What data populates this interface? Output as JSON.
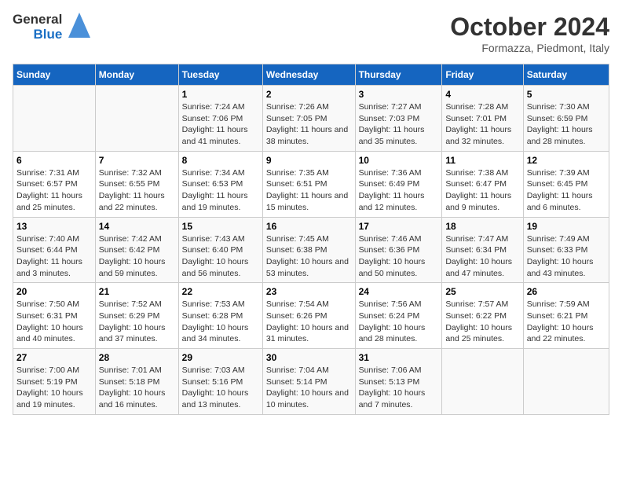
{
  "logo": {
    "general": "General",
    "blue": "Blue"
  },
  "title": "October 2024",
  "subtitle": "Formazza, Piedmont, Italy",
  "days_header": [
    "Sunday",
    "Monday",
    "Tuesday",
    "Wednesday",
    "Thursday",
    "Friday",
    "Saturday"
  ],
  "weeks": [
    [
      {
        "day": "",
        "info": ""
      },
      {
        "day": "",
        "info": ""
      },
      {
        "day": "1",
        "info": "Sunrise: 7:24 AM\nSunset: 7:06 PM\nDaylight: 11 hours and 41 minutes."
      },
      {
        "day": "2",
        "info": "Sunrise: 7:26 AM\nSunset: 7:05 PM\nDaylight: 11 hours and 38 minutes."
      },
      {
        "day": "3",
        "info": "Sunrise: 7:27 AM\nSunset: 7:03 PM\nDaylight: 11 hours and 35 minutes."
      },
      {
        "day": "4",
        "info": "Sunrise: 7:28 AM\nSunset: 7:01 PM\nDaylight: 11 hours and 32 minutes."
      },
      {
        "day": "5",
        "info": "Sunrise: 7:30 AM\nSunset: 6:59 PM\nDaylight: 11 hours and 28 minutes."
      }
    ],
    [
      {
        "day": "6",
        "info": "Sunrise: 7:31 AM\nSunset: 6:57 PM\nDaylight: 11 hours and 25 minutes."
      },
      {
        "day": "7",
        "info": "Sunrise: 7:32 AM\nSunset: 6:55 PM\nDaylight: 11 hours and 22 minutes."
      },
      {
        "day": "8",
        "info": "Sunrise: 7:34 AM\nSunset: 6:53 PM\nDaylight: 11 hours and 19 minutes."
      },
      {
        "day": "9",
        "info": "Sunrise: 7:35 AM\nSunset: 6:51 PM\nDaylight: 11 hours and 15 minutes."
      },
      {
        "day": "10",
        "info": "Sunrise: 7:36 AM\nSunset: 6:49 PM\nDaylight: 11 hours and 12 minutes."
      },
      {
        "day": "11",
        "info": "Sunrise: 7:38 AM\nSunset: 6:47 PM\nDaylight: 11 hours and 9 minutes."
      },
      {
        "day": "12",
        "info": "Sunrise: 7:39 AM\nSunset: 6:45 PM\nDaylight: 11 hours and 6 minutes."
      }
    ],
    [
      {
        "day": "13",
        "info": "Sunrise: 7:40 AM\nSunset: 6:44 PM\nDaylight: 11 hours and 3 minutes."
      },
      {
        "day": "14",
        "info": "Sunrise: 7:42 AM\nSunset: 6:42 PM\nDaylight: 10 hours and 59 minutes."
      },
      {
        "day": "15",
        "info": "Sunrise: 7:43 AM\nSunset: 6:40 PM\nDaylight: 10 hours and 56 minutes."
      },
      {
        "day": "16",
        "info": "Sunrise: 7:45 AM\nSunset: 6:38 PM\nDaylight: 10 hours and 53 minutes."
      },
      {
        "day": "17",
        "info": "Sunrise: 7:46 AM\nSunset: 6:36 PM\nDaylight: 10 hours and 50 minutes."
      },
      {
        "day": "18",
        "info": "Sunrise: 7:47 AM\nSunset: 6:34 PM\nDaylight: 10 hours and 47 minutes."
      },
      {
        "day": "19",
        "info": "Sunrise: 7:49 AM\nSunset: 6:33 PM\nDaylight: 10 hours and 43 minutes."
      }
    ],
    [
      {
        "day": "20",
        "info": "Sunrise: 7:50 AM\nSunset: 6:31 PM\nDaylight: 10 hours and 40 minutes."
      },
      {
        "day": "21",
        "info": "Sunrise: 7:52 AM\nSunset: 6:29 PM\nDaylight: 10 hours and 37 minutes."
      },
      {
        "day": "22",
        "info": "Sunrise: 7:53 AM\nSunset: 6:28 PM\nDaylight: 10 hours and 34 minutes."
      },
      {
        "day": "23",
        "info": "Sunrise: 7:54 AM\nSunset: 6:26 PM\nDaylight: 10 hours and 31 minutes."
      },
      {
        "day": "24",
        "info": "Sunrise: 7:56 AM\nSunset: 6:24 PM\nDaylight: 10 hours and 28 minutes."
      },
      {
        "day": "25",
        "info": "Sunrise: 7:57 AM\nSunset: 6:22 PM\nDaylight: 10 hours and 25 minutes."
      },
      {
        "day": "26",
        "info": "Sunrise: 7:59 AM\nSunset: 6:21 PM\nDaylight: 10 hours and 22 minutes."
      }
    ],
    [
      {
        "day": "27",
        "info": "Sunrise: 7:00 AM\nSunset: 5:19 PM\nDaylight: 10 hours and 19 minutes."
      },
      {
        "day": "28",
        "info": "Sunrise: 7:01 AM\nSunset: 5:18 PM\nDaylight: 10 hours and 16 minutes."
      },
      {
        "day": "29",
        "info": "Sunrise: 7:03 AM\nSunset: 5:16 PM\nDaylight: 10 hours and 13 minutes."
      },
      {
        "day": "30",
        "info": "Sunrise: 7:04 AM\nSunset: 5:14 PM\nDaylight: 10 hours and 10 minutes."
      },
      {
        "day": "31",
        "info": "Sunrise: 7:06 AM\nSunset: 5:13 PM\nDaylight: 10 hours and 7 minutes."
      },
      {
        "day": "",
        "info": ""
      },
      {
        "day": "",
        "info": ""
      }
    ]
  ]
}
